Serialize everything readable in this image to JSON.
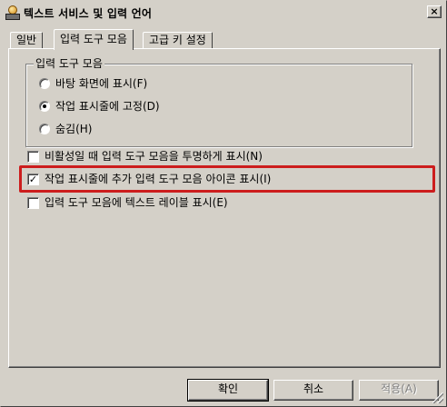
{
  "window": {
    "title": "텍스트 서비스 및 입력 언어",
    "close_glyph": "×"
  },
  "tabs": [
    {
      "label": "일반",
      "active": false
    },
    {
      "label": "입력 도구 모음",
      "active": true
    },
    {
      "label": "고급 키 설정",
      "active": false
    }
  ],
  "toolbar_group": {
    "legend": "입력 도구 모음",
    "options": [
      {
        "label": "바탕 화면에 표시(F)",
        "selected": false
      },
      {
        "label": "작업 표시줄에 고정(D)",
        "selected": true
      },
      {
        "label": "숨김(H)",
        "selected": false
      }
    ]
  },
  "checkboxes": [
    {
      "label": "비활성일 때 입력 도구 모음을 투명하게 표시(N)",
      "checked": false
    },
    {
      "label": "작업 표시줄에 추가 입력 도구 모음 아이콘 표시(I)",
      "checked": true,
      "highlighted": true
    },
    {
      "label": "입력 도구 모음에 텍스트 레이블 표시(E)",
      "checked": false
    }
  ],
  "buttons": {
    "ok": "확인",
    "cancel": "취소",
    "apply": "적용(A)"
  },
  "colors": {
    "dialog_face": "#d4d0c8",
    "highlight_border": "#cc1d1d"
  }
}
